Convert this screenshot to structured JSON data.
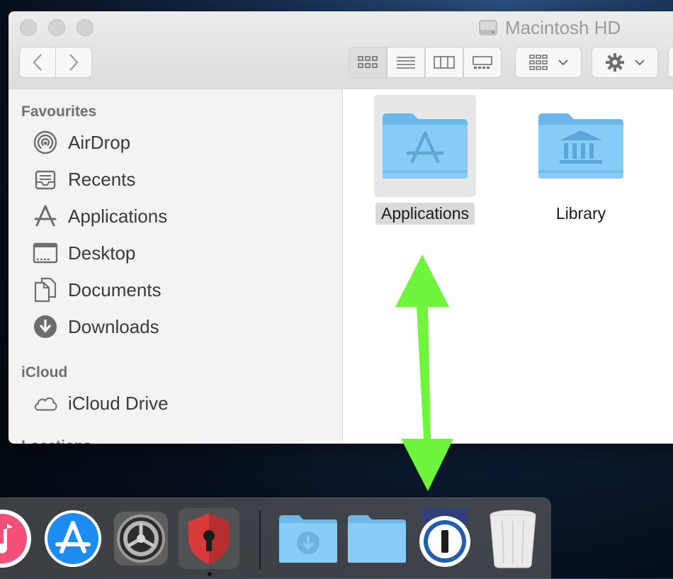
{
  "window": {
    "title": "Macintosh HD"
  },
  "sidebar": {
    "sections": [
      {
        "title": "Favourites"
      },
      {
        "title": "iCloud"
      },
      {
        "title": "Locations"
      }
    ],
    "favourites": [
      {
        "label": "AirDrop",
        "icon": "airdrop-icon"
      },
      {
        "label": "Recents",
        "icon": "recents-icon"
      },
      {
        "label": "Applications",
        "icon": "applications-icon"
      },
      {
        "label": "Desktop",
        "icon": "desktop-icon"
      },
      {
        "label": "Documents",
        "icon": "documents-icon"
      },
      {
        "label": "Downloads",
        "icon": "downloads-icon"
      }
    ],
    "icloud": [
      {
        "label": "iCloud Drive",
        "icon": "cloud-icon"
      }
    ]
  },
  "files": [
    {
      "name": "Applications",
      "selected": true,
      "icon": "applications-folder-icon"
    },
    {
      "name": "Library",
      "selected": false,
      "icon": "library-folder-icon"
    }
  ],
  "colors": {
    "folder": "#7cc4f2",
    "arrow": "#6ff53c",
    "selection": "#e6e6e6"
  },
  "dock": {
    "items": [
      "itunes-icon",
      "app-store-icon",
      "system-preferences-icon",
      "shield-keyhole-icon",
      "downloads-stack-icon",
      "folder-stack-icon",
      "1password-icon",
      "trash-icon"
    ]
  }
}
